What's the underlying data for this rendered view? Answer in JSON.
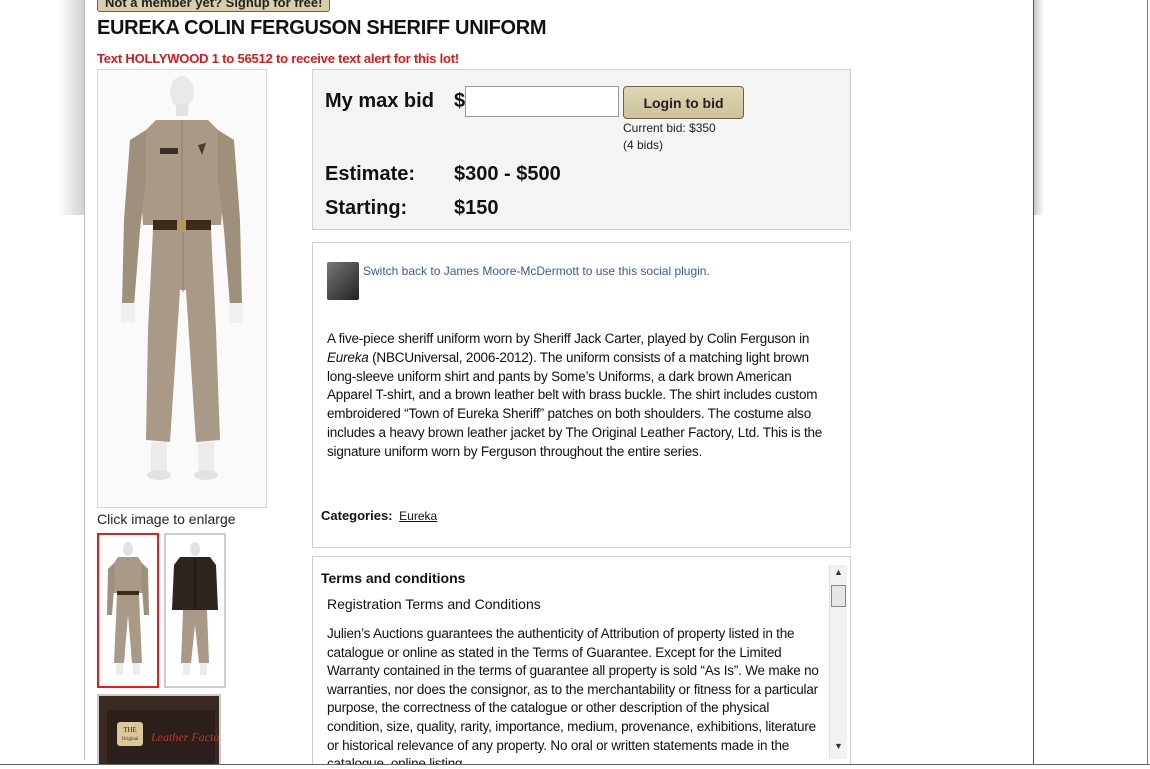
{
  "header": {
    "signup_label": "Not a member yet? Signup for free!",
    "lot_title": "EUREKA COLIN FERGUSON SHERIFF UNIFORM",
    "text_alert": "Text HOLLYWOOD 1 to 56512 to receive text alert for this lot!"
  },
  "gallery": {
    "caption": "Click image to enlarge",
    "thumbnail_count": 3,
    "selected_thumbnail": 1
  },
  "bid": {
    "max_bid_label": "My max bid",
    "currency_symbol": "$",
    "input_value": "",
    "login_label": "Login to bid",
    "current_bid": "Current bid: $350",
    "bid_count": "(4 bids)",
    "estimate_label": "Estimate:",
    "estimate_value": "$300 - $500",
    "starting_label": "Starting:",
    "starting_value": "$150"
  },
  "social": {
    "link_text": "Switch back to James Moore-McDermott to use this social plugin."
  },
  "description": {
    "text_before": "A five-piece sheriff uniform worn by Sheriff Jack Carter, played by Colin Ferguson in ",
    "show_title": "Eureka",
    "text_after": " (NBCUniversal, 2006-2012). The uniform consists of a matching light brown long-sleeve uniform shirt and pants by Some’s Uniforms, a dark brown American Apparel T-shirt, and a brown leather belt with brass buckle. The shirt includes custom embroidered “Town of Eureka Sheriff” patches on both shoulders. The costume also includes a heavy brown leather jacket by The Original Leather Factory, Ltd. This is the signature uniform worn by Ferguson throughout the entire series."
  },
  "categories": {
    "label": "Categories:",
    "link": "Eureka"
  },
  "terms": {
    "heading": "Terms and conditions",
    "subheading": "Registration Terms and Conditions",
    "body": "Julien’s Auctions guarantees the authenticity of Attribution of property listed in the catalogue or online as stated in the Terms of Guarantee. Except for the Limited Warranty contained in the terms of guarantee all property is sold “As Is”. We make no warranties, nor does the consignor, as to the merchantability or fitness for a particular purpose, the correctness of the catalogue or other description of the physical condition, size, quality, rarity, importance, medium, provenance, exhibitions, literature or historical relevance of any property. No oral or written statements made in the catalogue, online listing,"
  },
  "thumb3_logo": {
    "badge": "THE Original",
    "script": "Leather Factory"
  },
  "colors": {
    "alert_red": "#d41b1b",
    "button_tan": "#d8ceaa",
    "link_blue": "#3b5998",
    "uniform_khaki": "#a89a86",
    "jacket_brown": "#3b2a22"
  }
}
